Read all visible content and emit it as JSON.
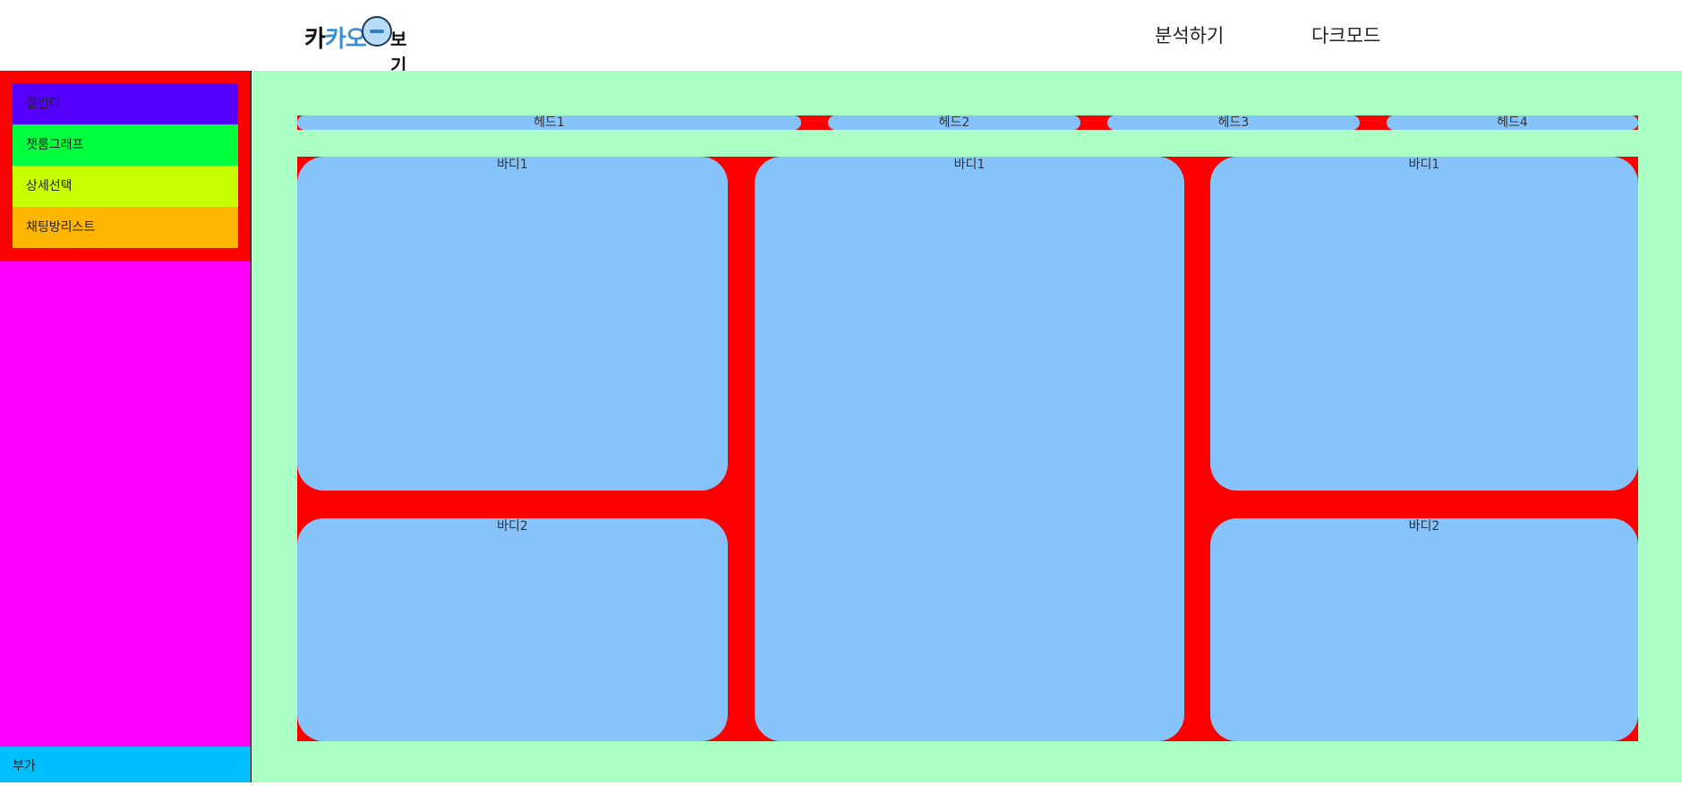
{
  "header": {
    "logo_text": "카카오톡보기",
    "nav": [
      "분석하기",
      "다크모드"
    ]
  },
  "sidebar": {
    "items": [
      {
        "label": "캘린더"
      },
      {
        "label": "챗룸그래프"
      },
      {
        "label": "상세선택"
      },
      {
        "label": "채팅방리스트"
      }
    ],
    "extra_label": "부가"
  },
  "main": {
    "heads": [
      "헤드1",
      "헤드2",
      "헤드3",
      "헤드4"
    ],
    "cards": {
      "left_top": "바디1",
      "left_bottom": "바디2",
      "middle": "바디1",
      "right_top": "바디1",
      "right_bottom": "바디2"
    }
  },
  "colors": {
    "sidebar_bg": "#ff00ff",
    "menu_wrap": "#ff0000",
    "menu_item_colors": [
      "#5500ff",
      "#00ff3c",
      "#c8ff00",
      "#ffb600"
    ],
    "extra_bg": "#00bfff",
    "main_bg": "#aaffc4",
    "panel_bg": "#87c3fb",
    "gap_color": "#ff0000"
  }
}
